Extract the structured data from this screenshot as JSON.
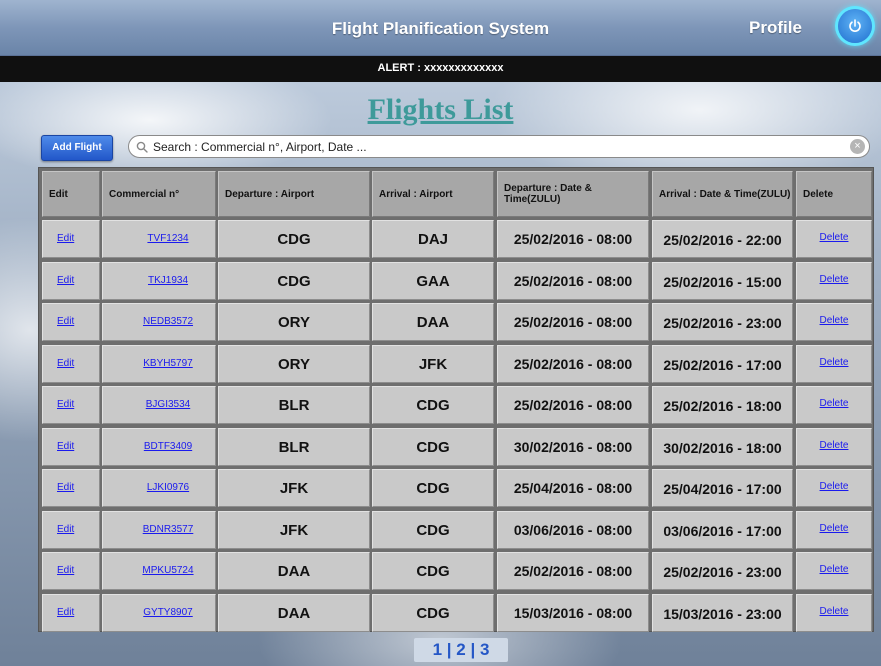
{
  "header": {
    "title": "Flight Planification System",
    "profile_label": "Profile"
  },
  "alert": {
    "text": "ALERT : xxxxxxxxxxxxx"
  },
  "page": {
    "title": "Flights List"
  },
  "toolbar": {
    "add_flight_label": "Add Flight",
    "search_placeholder": "Search : Commercial n°, Airport, Date ..."
  },
  "table": {
    "headers": {
      "edit": "Edit",
      "commercial": "Commercial n°",
      "departure_airport": "Departure : Airport",
      "arrival_airport": "Arrival : Airport",
      "departure_datetime": "Departure : Date & Time(ZULU)",
      "arrival_datetime": "Arrival : Date & Time(ZULU)",
      "delete": "Delete"
    },
    "rows": [
      {
        "edit": "Edit",
        "commercial": "TVF1234",
        "dep": "CDG",
        "arr": "DAJ",
        "dep_dt": "25/02/2016 - 08:00",
        "arr_dt": "25/02/2016 - 22:00",
        "delete": "Delete"
      },
      {
        "edit": "Edit",
        "commercial": "TKJ1934",
        "dep": "CDG",
        "arr": "GAA",
        "dep_dt": "25/02/2016 - 08:00",
        "arr_dt": "25/02/2016 - 15:00",
        "delete": "Delete"
      },
      {
        "edit": "Edit",
        "commercial": "NEDB3572",
        "dep": "ORY",
        "arr": "DAA",
        "dep_dt": "25/02/2016 - 08:00",
        "arr_dt": "25/02/2016 - 23:00",
        "delete": "Delete"
      },
      {
        "edit": "Edit",
        "commercial": "KBYH5797",
        "dep": "ORY",
        "arr": "JFK",
        "dep_dt": "25/02/2016 - 08:00",
        "arr_dt": "25/02/2016 - 17:00",
        "delete": "Delete"
      },
      {
        "edit": "Edit",
        "commercial": "BJGI3534",
        "dep": "BLR",
        "arr": "CDG",
        "dep_dt": "25/02/2016 - 08:00",
        "arr_dt": "25/02/2016 - 18:00",
        "delete": "Delete"
      },
      {
        "edit": "Edit",
        "commercial": "BDTF3409",
        "dep": "BLR",
        "arr": "CDG",
        "dep_dt": "30/02/2016 - 08:00",
        "arr_dt": "30/02/2016 - 18:00",
        "delete": "Delete"
      },
      {
        "edit": "Edit",
        "commercial": "LJKI0976",
        "dep": "JFK",
        "arr": "CDG",
        "dep_dt": "25/04/2016 - 08:00",
        "arr_dt": "25/04/2016 - 17:00",
        "delete": "Delete"
      },
      {
        "edit": "Edit",
        "commercial": "BDNR3577",
        "dep": "JFK",
        "arr": "CDG",
        "dep_dt": "03/06/2016 - 08:00",
        "arr_dt": "03/06/2016 - 17:00",
        "delete": "Delete"
      },
      {
        "edit": "Edit",
        "commercial": "MPKU5724",
        "dep": "DAA",
        "arr": "CDG",
        "dep_dt": "25/02/2016 - 08:00",
        "arr_dt": "25/02/2016 - 23:00",
        "delete": "Delete"
      },
      {
        "edit": "Edit",
        "commercial": "GYTY8907",
        "dep": "DAA",
        "arr": "CDG",
        "dep_dt": "15/03/2016 - 08:00",
        "arr_dt": "15/03/2016 - 23:00",
        "delete": "Delete"
      }
    ]
  },
  "pagination": {
    "page_1": "1",
    "sep_1": "|",
    "page_2": "2",
    "sep_2": "|",
    "page_3": "3"
  },
  "colors": {
    "title_bar": "#7e96b8",
    "alert_bar": "#101010",
    "page_title": "#3e9a9a",
    "link": "#1a1aee",
    "add_button": "#2f6de0"
  },
  "icons": {
    "power": "power-icon",
    "search": "search-icon",
    "clear": "clear-icon"
  }
}
